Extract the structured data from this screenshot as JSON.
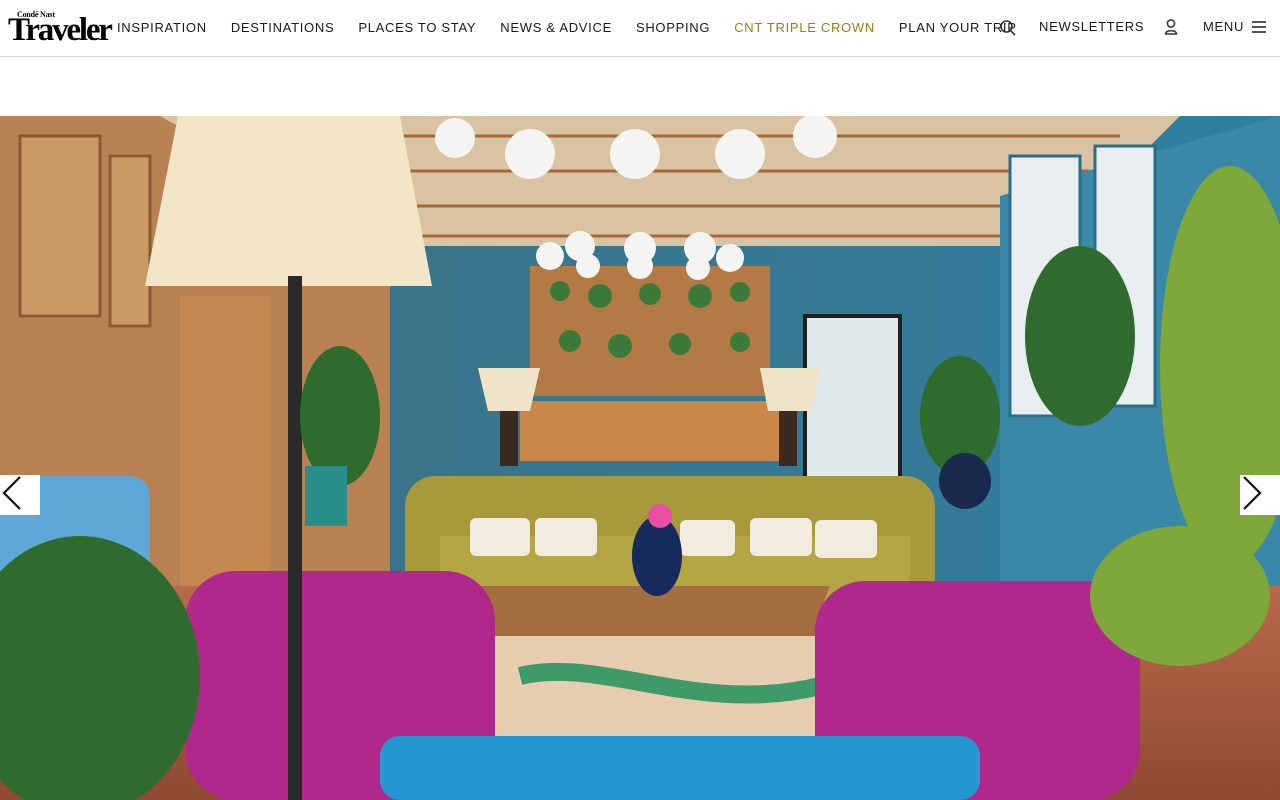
{
  "header": {
    "logo_small": "Condé Nast",
    "logo_big": "Traveler",
    "nav": [
      {
        "label": "INSPIRATION"
      },
      {
        "label": "DESTINATIONS"
      },
      {
        "label": "PLACES TO STAY"
      },
      {
        "label": "NEWS & ADVICE"
      },
      {
        "label": "SHOPPING"
      },
      {
        "label": "CNT TRIPLE CROWN",
        "accent": true
      },
      {
        "label": "PLAN YOUR TRIP"
      }
    ],
    "newsletters": "NEWSLETTERS",
    "menu": "MENU",
    "accent_color": "#a07b10"
  },
  "gallery": {
    "prev_icon": "chevron-left-icon",
    "next_icon": "chevron-right-icon"
  }
}
